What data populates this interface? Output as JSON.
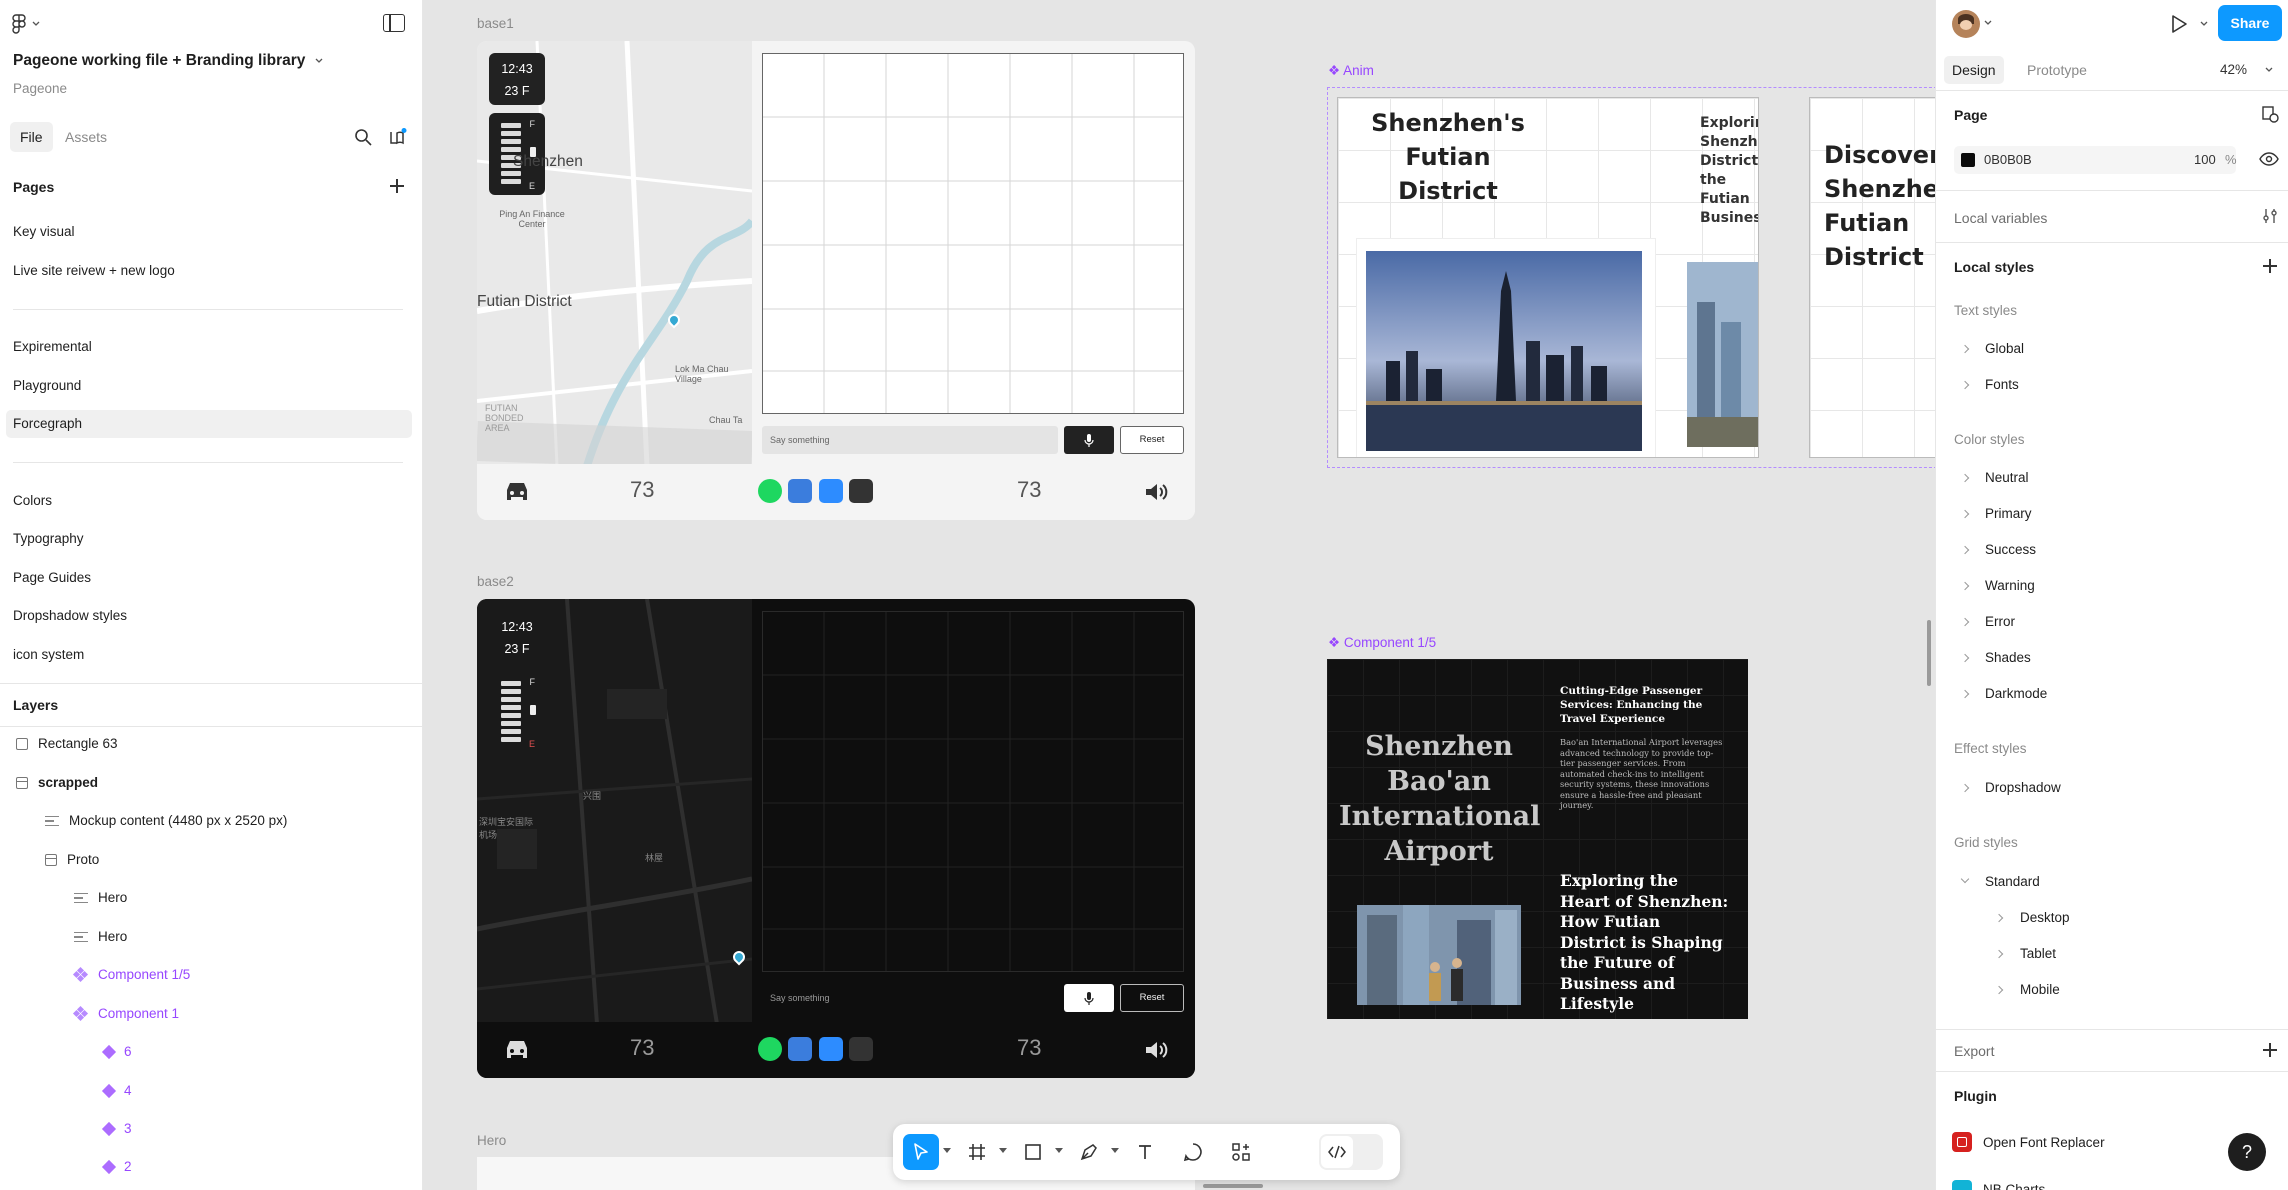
{
  "left_panel": {
    "file_title": "Pageone working file + Branding library",
    "file_subtitle": "Pageone",
    "tabs": [
      "File",
      "Assets"
    ],
    "pages_heading": "Pages",
    "pages_group1": [
      "Key visual",
      "Live site reivew + new logo"
    ],
    "pages_group2": [
      "Expiremental",
      "Playground",
      "Forcegraph"
    ],
    "pages_group3": [
      "Colors",
      "Typography",
      "Page Guides",
      "Dropshadow styles",
      "icon system"
    ],
    "layers_heading": "Layers",
    "layers": [
      {
        "label": "Rectangle 63"
      },
      {
        "label": "scrapped"
      },
      {
        "label": "Mockup content (4480 px x 2520 px)"
      },
      {
        "label": "Proto"
      },
      {
        "label": "Hero"
      },
      {
        "label": "Hero"
      },
      {
        "label": "Component 1/5"
      },
      {
        "label": "Component 1"
      },
      {
        "label": "6"
      },
      {
        "label": "4"
      },
      {
        "label": "3"
      },
      {
        "label": "2"
      }
    ]
  },
  "canvas": {
    "frame_labels": {
      "base1": "base1",
      "base2": "base2",
      "anim": "Anim",
      "component": "Component 1/5",
      "hero": "Hero"
    },
    "dashboard1": {
      "time": "12:43",
      "temp": "23 F",
      "batt_full": "F",
      "batt_empty": "E",
      "map_labels": [
        "Shenzhen",
        "Futian District",
        "Ping An Finance Center",
        "Lok Ma Chau Village",
        "Chau Ta",
        "FUTIAN BONDED AREA"
      ],
      "input_placeholder": "Say something",
      "reset_label": "Reset",
      "left_num": "73",
      "right_num": "73"
    },
    "dashboard2": {
      "time": "12:43",
      "temp": "23 F",
      "batt_full": "F",
      "batt_empty": "E",
      "map_labels": [
        "深圳宝安国际机场",
        "兴围",
        "林屋"
      ],
      "input_placeholder": "Say something",
      "reset_label": "Reset",
      "left_num": "73",
      "right_num": "73"
    },
    "anim": {
      "title1": "Shenzhen's Futian District",
      "side1": "Exploring Shenzhen District: the Futian Business",
      "title2": "Discover Shenzhen Futian District"
    },
    "component": {
      "title": "Shenzhen Bao'an International Airport",
      "small_title": "Cutting-Edge Passenger Services: Enhancing the Travel Experience",
      "body": "Bao'an International Airport leverages advanced technology to provide top-tier passenger services. From automated check-ins to intelligent security systems, these innovations ensure a hassle-free and pleasant journey.",
      "big_title": "Exploring the Heart of Shenzhen: How Futian District is Shaping the Future of Business and Lifestyle"
    }
  },
  "right_panel": {
    "share_label": "Share",
    "tabs": [
      "Design",
      "Prototype"
    ],
    "zoom": "42%",
    "page_heading": "Page",
    "page_color_hex": "0B0B0B",
    "page_opacity": "100",
    "opacity_unit": "%",
    "local_variables": "Local variables",
    "local_styles": "Local styles",
    "text_styles_heading": "Text styles",
    "text_styles": [
      "Global",
      "Fonts"
    ],
    "color_styles_heading": "Color styles",
    "color_styles": [
      "Neutral",
      "Primary",
      "Success",
      "Warning",
      "Error",
      "Shades",
      "Darkmode"
    ],
    "effect_styles_heading": "Effect styles",
    "effect_styles": [
      "Dropshadow"
    ],
    "grid_styles_heading": "Grid styles",
    "grid_styles": {
      "parent": "Standard",
      "children": [
        "Desktop",
        "Tablet",
        "Mobile"
      ]
    },
    "export_heading": "Export",
    "plugin_heading": "Plugin",
    "plugins": [
      "Open Font Replacer",
      "NB Charts"
    ],
    "help": "?"
  },
  "colors": {
    "accent": "#0d99ff",
    "component_purple": "#9747ff",
    "page_swatch": "#0b0b0b"
  }
}
